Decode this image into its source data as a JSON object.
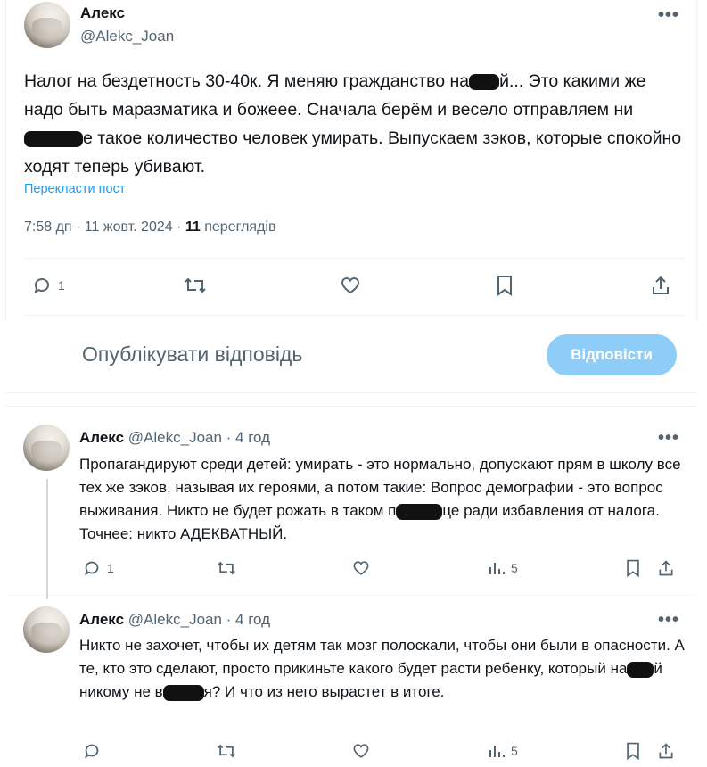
{
  "main_tweet": {
    "name": "Алекс",
    "handle": "@Alekc_Joan",
    "more": "•••",
    "text_parts": [
      "Налог на бездетность 30-40к. Я меняю гражданство на",
      "й... Это какими же надо быть маразматика и божеее. Сначала берём и весело отправляем ни",
      "е такое количество человек умирать. Выпускаем зэков, которые спокойно ходят теперь убивают."
    ],
    "translate": "Перекласти пост",
    "time": "7:58 дп · 11 жовт. 2024 · ",
    "views_count": "11",
    "views_label": " переглядів",
    "reply_count": "1"
  },
  "reply_box": {
    "placeholder": "Опублікувати відповідь",
    "button": "Відповісти"
  },
  "replies": [
    {
      "name": "Алекс",
      "handle": "@Alekc_Joan · 4 год",
      "text_parts": [
        "Пропагандируют среди детей: умирать - это нормально, допускают прям в школу все тех же зэков, называя их героями, а потом такие: Вопрос демографии - это вопрос выживания. Никто не будет рожать в таком п",
        "це ради избавления от налога. Точнее: никто АДЕКВАТНЫЙ."
      ],
      "reply_count": "1",
      "views": "5"
    },
    {
      "name": "Алекс",
      "handle": "@Alekc_Joan · 4 год",
      "text_parts": [
        "Никто не захочет, чтобы их детям так мозг полоскали, чтобы они были в опасности. А те, кто это сделают, просто прикиньте какого будет расти ребенку, который на",
        "й никому не в",
        "я? И что из него вырастет в итоге."
      ],
      "reply_count": "",
      "views": "5"
    }
  ],
  "colors": {
    "accent": "#1d9bf0",
    "button_disabled": "#8ecdf7",
    "secondary_text": "#536471",
    "divider": "#eff3f4"
  }
}
